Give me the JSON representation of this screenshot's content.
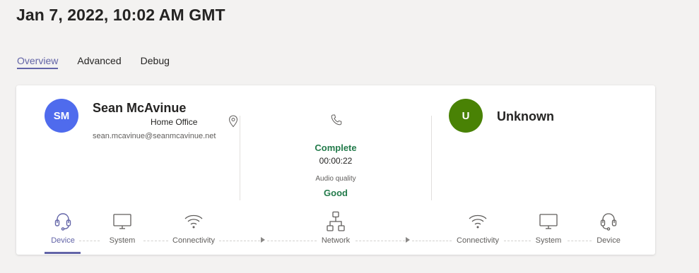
{
  "header": {
    "title": "Jan 7, 2022, 10:02 AM GMT"
  },
  "tabs": [
    {
      "label": "Overview",
      "active": true
    },
    {
      "label": "Advanced",
      "active": false
    },
    {
      "label": "Debug",
      "active": false
    }
  ],
  "caller": {
    "initials": "SM",
    "name": "Sean McAvinue",
    "location": "Home Office",
    "email": "sean.mcavinue@seanmcavinue.net",
    "avatar_color": "#4f6bed"
  },
  "callee": {
    "initials": "U",
    "name": "Unknown",
    "avatar_color": "#498205"
  },
  "call": {
    "status": "Complete",
    "duration": "00:00:22",
    "audio_quality_label": "Audio quality",
    "audio_quality_value": "Good",
    "status_color": "#237b4b"
  },
  "path": [
    {
      "label": "Device",
      "icon": "headset-icon",
      "selected": true
    },
    {
      "label": "System",
      "icon": "monitor-icon",
      "selected": false
    },
    {
      "label": "Connectivity",
      "icon": "wifi-icon",
      "selected": false
    },
    {
      "label": "Network",
      "icon": "network-icon",
      "selected": false
    },
    {
      "label": "Connectivity",
      "icon": "wifi-icon",
      "selected": false
    },
    {
      "label": "System",
      "icon": "monitor-icon",
      "selected": false
    },
    {
      "label": "Device",
      "icon": "headset-icon",
      "selected": false
    }
  ],
  "accent_color": "#6264a7"
}
